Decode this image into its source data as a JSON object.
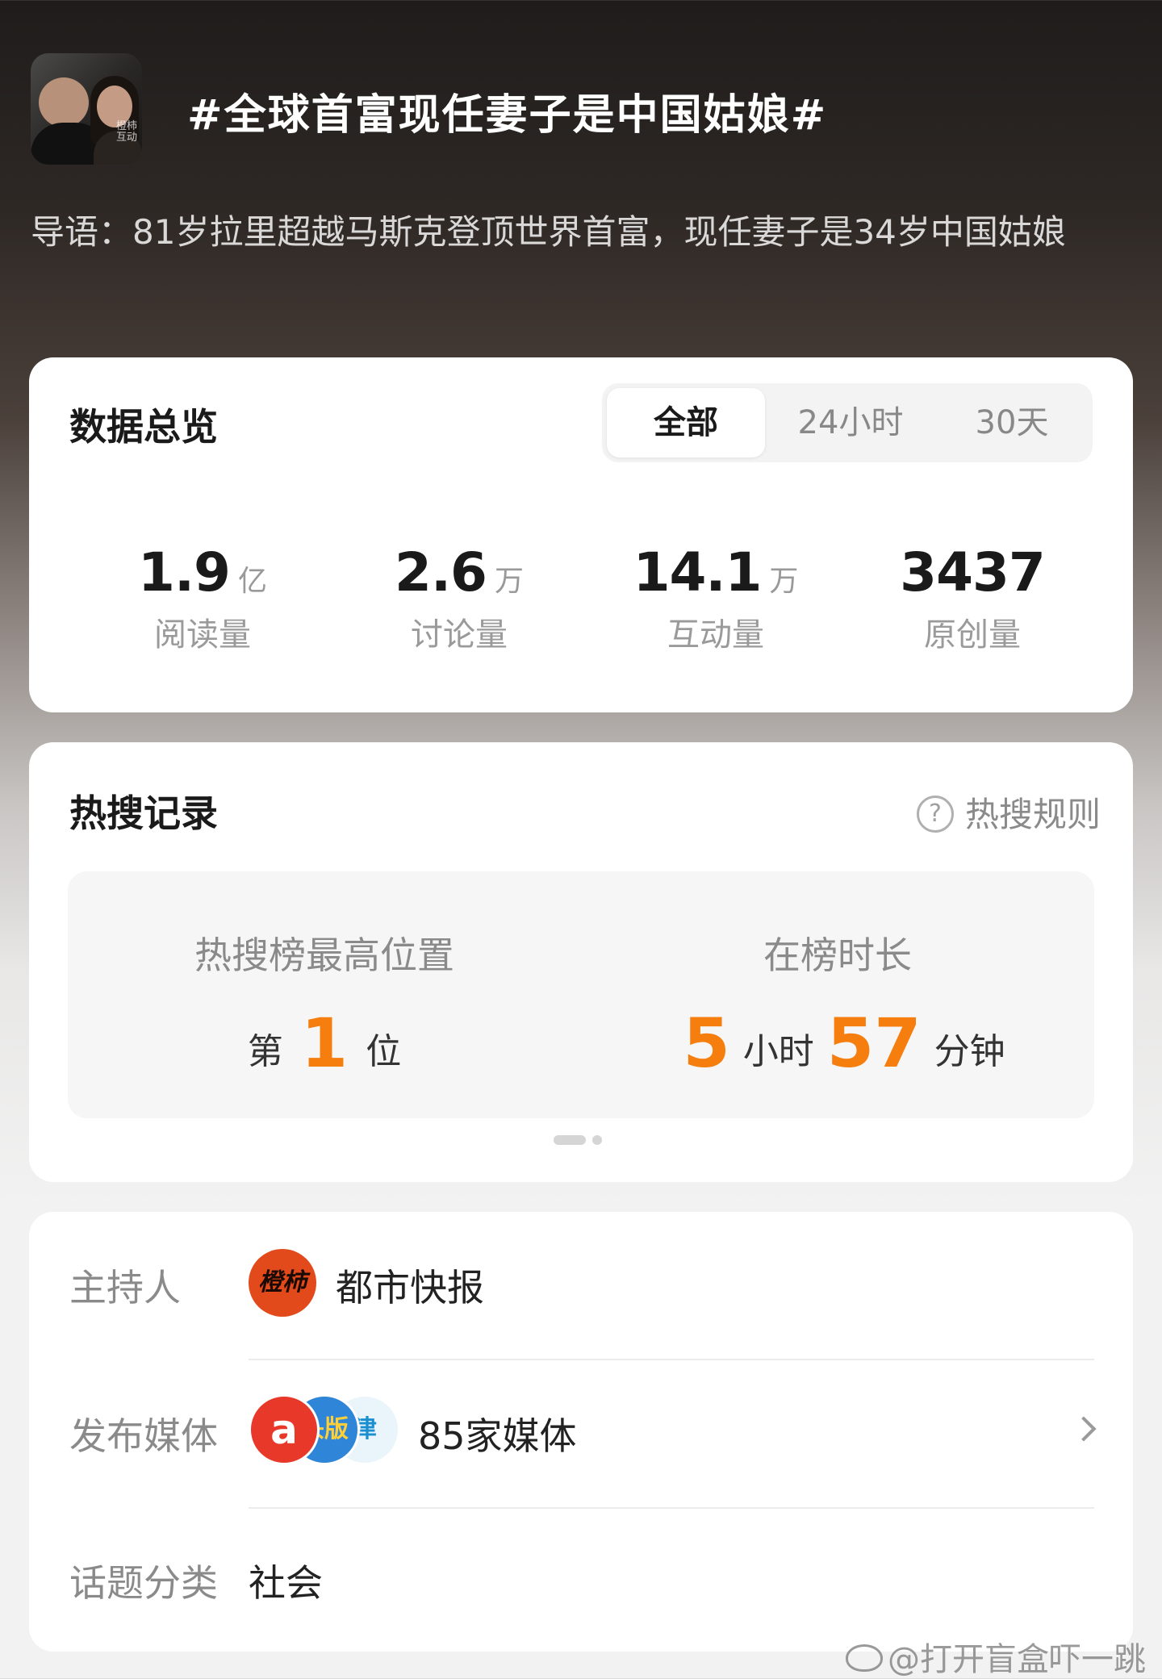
{
  "topic": {
    "title": "#全球首富现任妻子是中国姑娘#",
    "avatar_watermark": "橙柿互动",
    "intro": "导语：81岁拉里超越马斯克登顶世界首富，现任妻子是34岁中国姑娘"
  },
  "overview": {
    "title": "数据总览",
    "tabs": [
      {
        "label": "全部",
        "active": true
      },
      {
        "label": "24小时",
        "active": false
      },
      {
        "label": "30天",
        "active": false
      }
    ],
    "stats": [
      {
        "value": "1.9",
        "unit": "亿",
        "label": "阅读量"
      },
      {
        "value": "2.6",
        "unit": "万",
        "label": "讨论量"
      },
      {
        "value": "14.1",
        "unit": "万",
        "label": "互动量"
      },
      {
        "value": "3437",
        "unit": "",
        "label": "原创量"
      }
    ]
  },
  "hot_search": {
    "title": "热搜记录",
    "rules_label": "热搜规则",
    "rules_icon": "?",
    "highest_position": {
      "label": "热搜榜最高位置",
      "prefix": "第",
      "value": "1",
      "suffix": "位"
    },
    "duration": {
      "label": "在榜时长",
      "hours": "5",
      "hours_unit": "小时",
      "minutes": "57",
      "minutes_unit": "分钟"
    },
    "accent_color": "#f57e0e"
  },
  "info": {
    "host": {
      "label": "主持人",
      "logo_text": "橙柿",
      "value": "都市快报"
    },
    "media": {
      "label": "发布媒体",
      "logo_texts": [
        "a",
        "头版",
        "津"
      ],
      "value": "85家媒体"
    },
    "category": {
      "label": "话题分类",
      "value": "社会"
    }
  },
  "watermark": "@打开盲盒吓一跳"
}
